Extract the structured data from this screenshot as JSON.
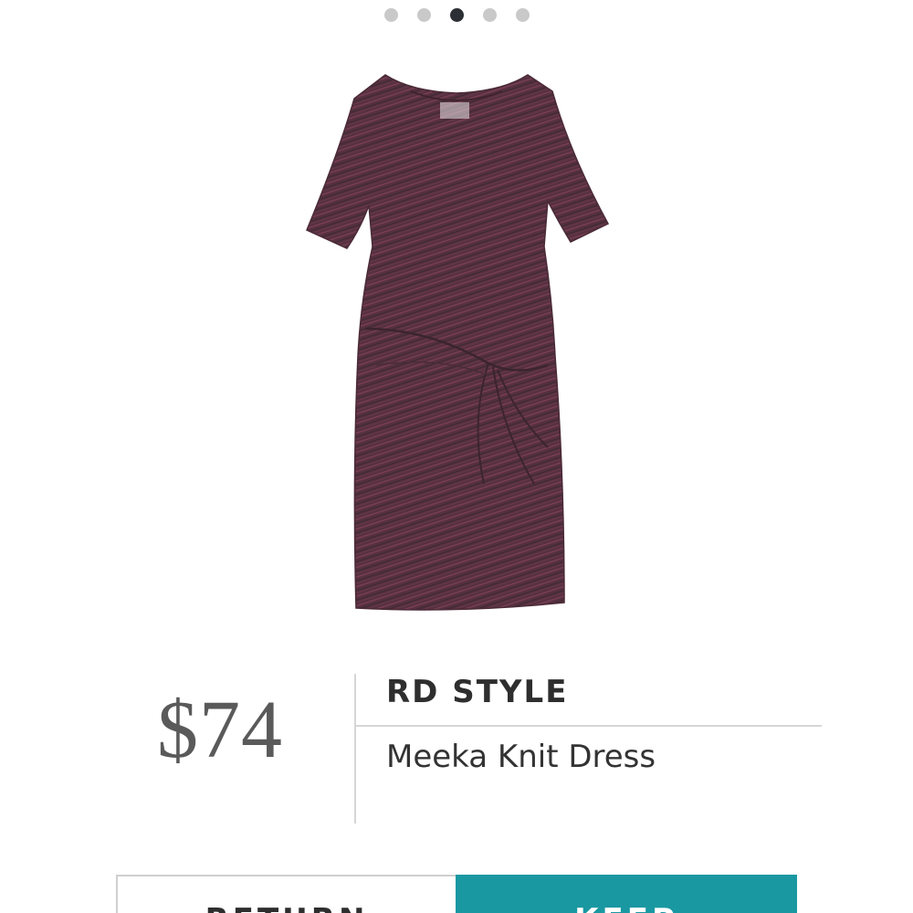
{
  "pager": {
    "total": 5,
    "active_index": 2
  },
  "product": {
    "image_description": "dress-photo",
    "color": "#5b2e3f",
    "price": "$74",
    "brand": "RD STYLE",
    "name": "Meeka Knit Dress"
  },
  "actions": {
    "return_label": "RETURN",
    "keep_label": "KEEP",
    "keep_color": "#1a98a2"
  }
}
